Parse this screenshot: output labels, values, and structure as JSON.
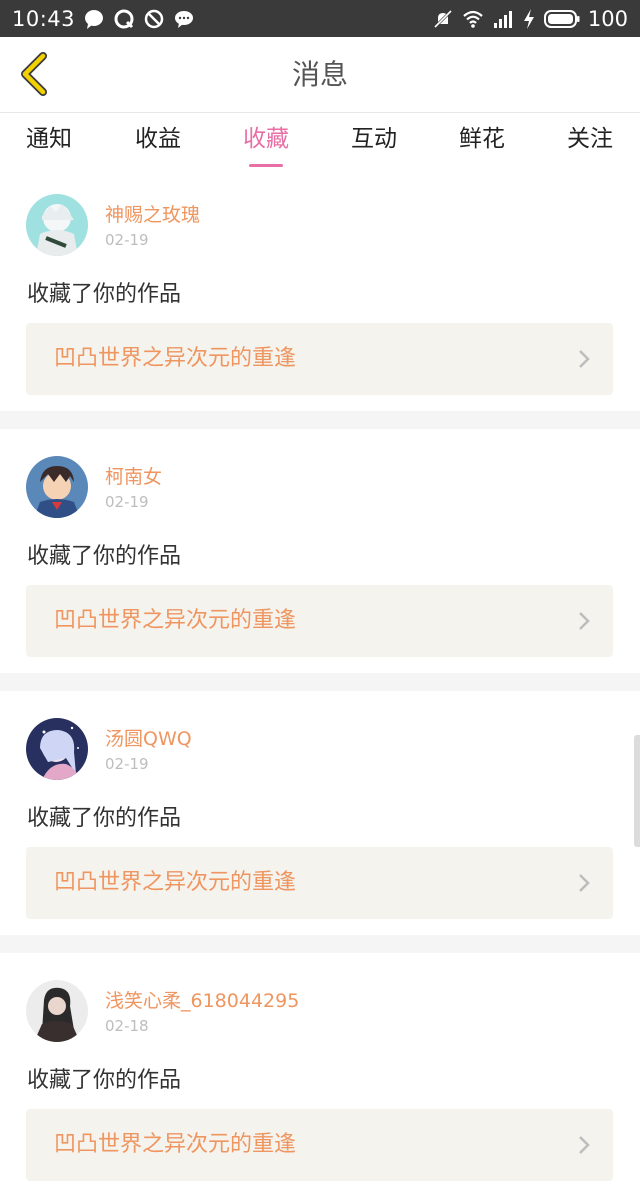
{
  "status_bar": {
    "time": "10:43",
    "battery": "100",
    "left_icons": [
      "chat-bubble-icon",
      "q-icon",
      "block-icon",
      "message-icon"
    ],
    "right_icons": [
      "mute-icon",
      "wifi-icon",
      "signal-icon",
      "charging-icon",
      "battery-icon"
    ]
  },
  "header": {
    "title": "消息",
    "back_icon": "chevron-left-icon",
    "accent": "#e6c200"
  },
  "tabs": [
    {
      "label": "通知",
      "active": false
    },
    {
      "label": "收益",
      "active": false
    },
    {
      "label": "收藏",
      "active": true
    },
    {
      "label": "互动",
      "active": false
    },
    {
      "label": "鲜花",
      "active": false
    },
    {
      "label": "关注",
      "active": false
    }
  ],
  "colors": {
    "active_tab": "#e86fa5",
    "username": "#ef9660",
    "work_title": "#ef9660",
    "work_bg": "#f4f3ee",
    "date": "#bdbdbd"
  },
  "feed": [
    {
      "username": "神赐之玫瑰",
      "date": "02-19",
      "action": "收藏了你的作品",
      "work_title": "凹凸世界之异次元的重逢",
      "avatar": "avatar-1"
    },
    {
      "username": "柯南女",
      "date": "02-19",
      "action": "收藏了你的作品",
      "work_title": "凹凸世界之异次元的重逢",
      "avatar": "avatar-2"
    },
    {
      "username": "汤圆QWQ",
      "date": "02-19",
      "action": "收藏了你的作品",
      "work_title": "凹凸世界之异次元的重逢",
      "avatar": "avatar-3"
    },
    {
      "username": "浅笑心柔_618044295",
      "date": "02-18",
      "action": "收藏了你的作品",
      "work_title": "凹凸世界之异次元的重逢",
      "avatar": "avatar-4"
    }
  ]
}
